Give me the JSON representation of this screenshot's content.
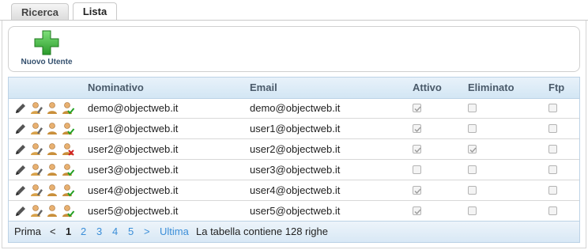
{
  "tabs": [
    {
      "label": "Ricerca"
    },
    {
      "label": "Lista"
    }
  ],
  "toolbar": {
    "new_user_label": "Nuovo Utente"
  },
  "grid": {
    "headers": {
      "nominativo": "Nominativo",
      "email": "Email",
      "attivo": "Attivo",
      "eliminato": "Eliminato",
      "ftp": "Ftp"
    },
    "rows": [
      {
        "nominativo": "demo@objectweb.it",
        "email": "demo@objectweb.it",
        "attivo": true,
        "eliminato": false,
        "ftp": false,
        "status_icon": "user-check-icon"
      },
      {
        "nominativo": "user1@objectweb.it",
        "email": "user1@objectweb.it",
        "attivo": true,
        "eliminato": false,
        "ftp": false,
        "status_icon": "user-check-icon"
      },
      {
        "nominativo": "user2@objectweb.it",
        "email": "user2@objectweb.it",
        "attivo": true,
        "eliminato": true,
        "ftp": false,
        "status_icon": "user-delete-icon"
      },
      {
        "nominativo": "user3@objectweb.it",
        "email": "user3@objectweb.it",
        "attivo": false,
        "eliminato": false,
        "ftp": false,
        "status_icon": "user-check-icon"
      },
      {
        "nominativo": "user4@objectweb.it",
        "email": "user4@objectweb.it",
        "attivo": true,
        "eliminato": false,
        "ftp": false,
        "status_icon": "user-check-icon"
      },
      {
        "nominativo": "user5@objectweb.it",
        "email": "user5@objectweb.it",
        "attivo": true,
        "eliminato": false,
        "ftp": false,
        "status_icon": "user-check-icon"
      }
    ]
  },
  "pager": {
    "first": "Prima",
    "prev": "<",
    "pages": [
      "1",
      "2",
      "3",
      "4",
      "5"
    ],
    "current": "1",
    "next": ">",
    "last": "Ultima",
    "info": "La tabella contiene 128 righe"
  },
  "colors": {
    "header_text": "#4a5a6a",
    "link": "#3b8ed8",
    "plus_green": "#3cb83c",
    "grid_border": "#bcd2e6"
  }
}
